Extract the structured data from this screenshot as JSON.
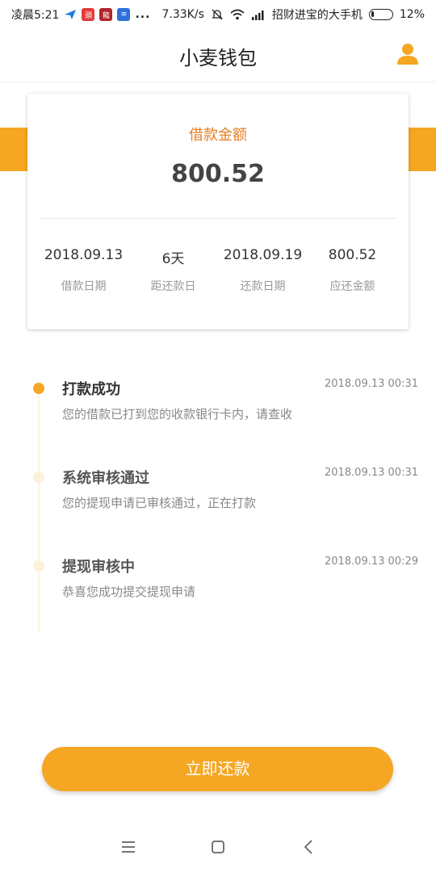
{
  "status_bar": {
    "time": "凌晨5:21",
    "app_icons": [
      "bird-icon",
      "app-badge-icon",
      "app-game-icon",
      "app-doc-icon"
    ],
    "more": "...",
    "net_speed": "7.33K/s",
    "carrier": "招财进宝的大手机",
    "battery": "12%"
  },
  "header": {
    "title": "小麦钱包",
    "profile_icon": "user-icon"
  },
  "loan_card": {
    "label": "借款金额",
    "amount": "800.52",
    "stats": [
      {
        "value": "2018.09.13",
        "label": "借款日期"
      },
      {
        "value": "6天",
        "label": "距还款日"
      },
      {
        "value": "2018.09.19",
        "label": "还款日期"
      },
      {
        "value": "800.52",
        "label": "应还金额"
      }
    ]
  },
  "timeline": [
    {
      "title": "打款成功",
      "time": "2018.09.13 00:31",
      "desc": "您的借款已打到您的收款银行卡内，请查收"
    },
    {
      "title": "系统审核通过",
      "time": "2018.09.13 00:31",
      "desc": "您的提现申请已审核通过，正在打款"
    },
    {
      "title": "提现审核中",
      "time": "2018.09.13 00:29",
      "desc": "恭喜您成功提交提现申请"
    }
  ],
  "repay_button": "立即还款",
  "colors": {
    "accent": "#f5a623",
    "label_orange": "#e67e22"
  },
  "navbar": [
    "menu-icon",
    "home-icon",
    "back-icon"
  ]
}
